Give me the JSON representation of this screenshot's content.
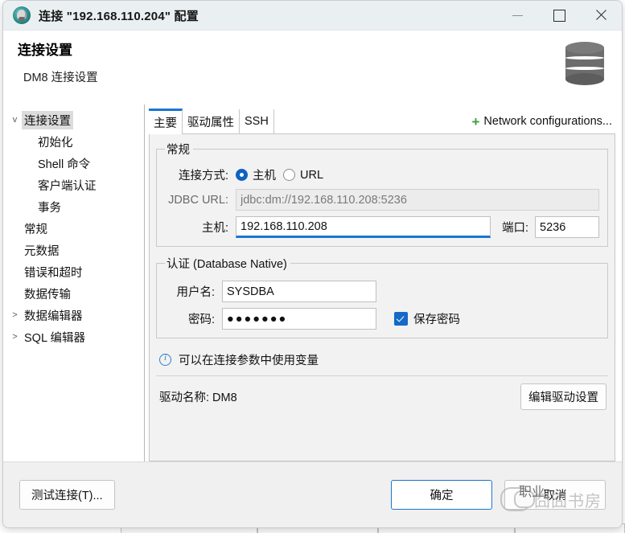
{
  "window": {
    "title": "连接 \"192.168.110.204\" 配置",
    "app_icon": "dbeaver-beaver-icon",
    "minimize_label": "最小化",
    "maximize_label": "最大化",
    "close_label": "关闭"
  },
  "header": {
    "title": "连接设置",
    "subtitle": "DM8 连接设置",
    "icon": "database-icon"
  },
  "sidebar": {
    "items": [
      {
        "label": "连接设置",
        "level": 0,
        "arrow": "v",
        "selected": true
      },
      {
        "label": "初始化",
        "level": 2,
        "arrow": "",
        "selected": false
      },
      {
        "label": "Shell 命令",
        "level": 2,
        "arrow": "",
        "selected": false
      },
      {
        "label": "客户端认证",
        "level": 2,
        "arrow": "",
        "selected": false
      },
      {
        "label": "事务",
        "level": 2,
        "arrow": "",
        "selected": false
      },
      {
        "label": "常规",
        "level": 1,
        "arrow": "",
        "selected": false
      },
      {
        "label": "元数据",
        "level": 1,
        "arrow": "",
        "selected": false
      },
      {
        "label": "错误和超时",
        "level": 1,
        "arrow": "",
        "selected": false
      },
      {
        "label": "数据传输",
        "level": 1,
        "arrow": "",
        "selected": false
      },
      {
        "label": "数据编辑器",
        "level": 0,
        "arrow": ">",
        "selected": false
      },
      {
        "label": "SQL 编辑器",
        "level": 0,
        "arrow": ">",
        "selected": false
      }
    ]
  },
  "tabs": {
    "items": [
      {
        "label": "主要",
        "active": true
      },
      {
        "label": "驱动属性",
        "active": false
      },
      {
        "label": "SSH",
        "active": false
      }
    ],
    "network_config_label": "Network configurations...",
    "network_config_plus": "+"
  },
  "general_group": {
    "legend": "常规",
    "connect_by_label": "连接方式:",
    "radios": [
      {
        "label": "主机",
        "checked": true
      },
      {
        "label": "URL",
        "checked": false
      }
    ],
    "jdbc_url_label": "JDBC URL:",
    "jdbc_url_value": "jdbc:dm://192.168.110.208:5236",
    "host_label": "主机:",
    "host_value": "192.168.110.208",
    "port_label": "端口:",
    "port_value": "5236"
  },
  "auth_group": {
    "legend": "认证 (Database Native)",
    "username_label": "用户名:",
    "username_value": "SYSDBA",
    "password_label": "密码:",
    "password_value": "●●●●●●●",
    "save_password_label": "保存密码",
    "save_password_checked": true
  },
  "info": {
    "icon": "info-circle-icon",
    "text": "可以在连接参数中使用变量"
  },
  "driver": {
    "label": "驱动名称: DM8",
    "edit_button": "编辑驱动设置"
  },
  "footer": {
    "test_connection": "测试连接(T)...",
    "ok": "确定",
    "cancel": "取消"
  },
  "watermark": {
    "text": "囧囧书房",
    "overlay_text": "职业",
    "logo": "wechat-logo-icon"
  },
  "colors": {
    "accent": "#1a76d2",
    "checkbox": "#1569c7",
    "radio": "#0f62c0",
    "plus_green": "#3aa23a",
    "titlebar": "#eaf0f2",
    "panel_bg": "#f2f2f2"
  }
}
